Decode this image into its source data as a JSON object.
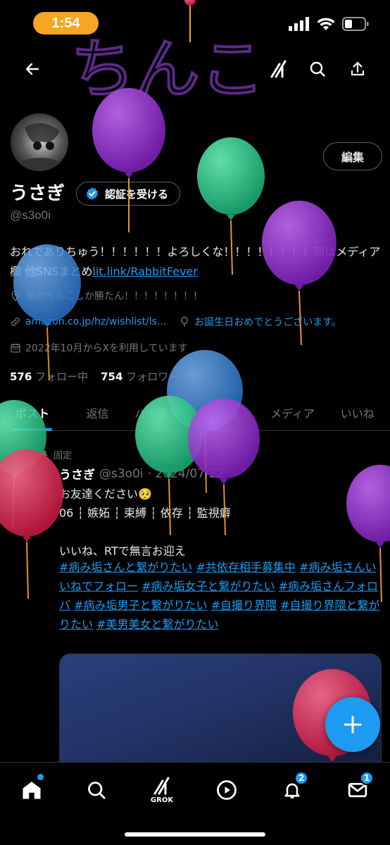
{
  "status_bar": {
    "time": "1:54"
  },
  "header": {
    "scribble_text": "ちんこ"
  },
  "profile": {
    "name": "うさぎ",
    "verify_label": "認証を受ける",
    "handle": "@s3o0i",
    "edit_label": "編集",
    "bio_text": "おれでありちゅう！！！！！！よろしくな！！！！！！！！顔はメディア欄 他SNSまとめ",
    "bio_link": "lit.link/RabbitFever",
    "location": "俺のちんこしか勝たん！！！！！！！！",
    "website": "amazon.co.jp/hz/wishlist/ls...",
    "birthday": "お誕生日おめでとうございます。",
    "joined": "2022年10月からXを利用しています",
    "following_count": "576",
    "following_label": "フォロー中",
    "followers_count": "754",
    "followers_label": "フォロワー"
  },
  "tabs": [
    "ポスト",
    "返信",
    "ハイライト",
    "記事",
    "メディア",
    "いいね"
  ],
  "post": {
    "pinned_label": "固定",
    "author_name": "うさぎ",
    "author_handle": "@s3o0i",
    "date": "· 2024/07/22",
    "more": "···",
    "line1": "お友達ください🥺",
    "line2": "06 ┆ 嫉妬 ┆ 束縛 ┆ 依存 ┆ 監視癖",
    "line3": "いいね、RTで無言お迎え",
    "hashtags": [
      "#病み垢さんと繋がりたい",
      "#共依存相手募集中",
      "#病み垢さんいいねでフォロー",
      "#病み垢女子と繋がりたい",
      "#病み垢さんフォロバ",
      "#病み垢男子と繋がりたい",
      "#自撮り界隈",
      "#自撮り界隈と繋がりたい",
      "#美男美女と繋がりたい"
    ]
  },
  "fab": {
    "icon": "plus-icon"
  },
  "bottom_nav": {
    "items": [
      {
        "name": "home",
        "icon": "home-icon"
      },
      {
        "name": "search",
        "icon": "search-icon"
      },
      {
        "name": "grok",
        "icon": "grok-icon",
        "label": "GROK"
      },
      {
        "name": "video",
        "icon": "play-icon"
      },
      {
        "name": "notifications",
        "icon": "bell-icon",
        "badge": "2"
      },
      {
        "name": "messages",
        "icon": "mail-icon",
        "badge": "1"
      }
    ]
  },
  "colors": {
    "accent": "#1d9bf0",
    "status_pill": "#f5a623",
    "balloon_purple": "#9b30d9",
    "balloon_green": "#2ecc8f",
    "balloon_blue": "#3d8fe0",
    "balloon_red": "#e0284f"
  }
}
